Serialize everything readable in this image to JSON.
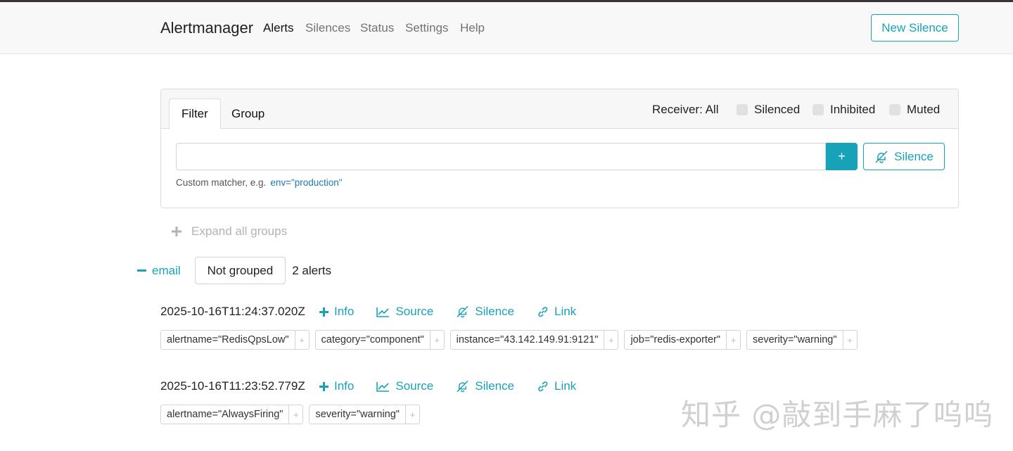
{
  "navbar": {
    "brand": "Alertmanager",
    "items": [
      "Alerts",
      "Silences",
      "Status",
      "Settings",
      "Help"
    ],
    "new_silence": "New Silence"
  },
  "filter_panel": {
    "tabs": [
      "Filter",
      "Group"
    ],
    "receiver": "Receiver: All",
    "checkboxes": [
      "Silenced",
      "Inhibited",
      "Muted"
    ],
    "input_value": "",
    "plus_label": "+",
    "silence_label": "Silence",
    "hint": "Custom matcher, e.g.",
    "hint_example": "env=\"production\""
  },
  "expand_all": "Expand all groups",
  "group": {
    "receiver": "email",
    "grouping": "Not grouped",
    "count": "2 alerts"
  },
  "actions": {
    "info": "Info",
    "source": "Source",
    "silence": "Silence",
    "link": "Link"
  },
  "alerts": [
    {
      "timestamp": "2025-10-16T11:24:37.020Z",
      "labels": [
        "alertname=\"RedisQpsLow\"",
        "category=\"component\"",
        "instance=\"43.142.149.91:9121\"",
        "job=\"redis-exporter\"",
        "severity=\"warning\""
      ]
    },
    {
      "timestamp": "2025-10-16T11:23:52.779Z",
      "labels": [
        "alertname=\"AlwaysFiring\"",
        "severity=\"warning\""
      ]
    }
  ],
  "watermark": "知乎 @敲到手麻了呜呜",
  "colors": {
    "accent": "#17a2b8",
    "navbar_bg": "#f8f8f8"
  }
}
